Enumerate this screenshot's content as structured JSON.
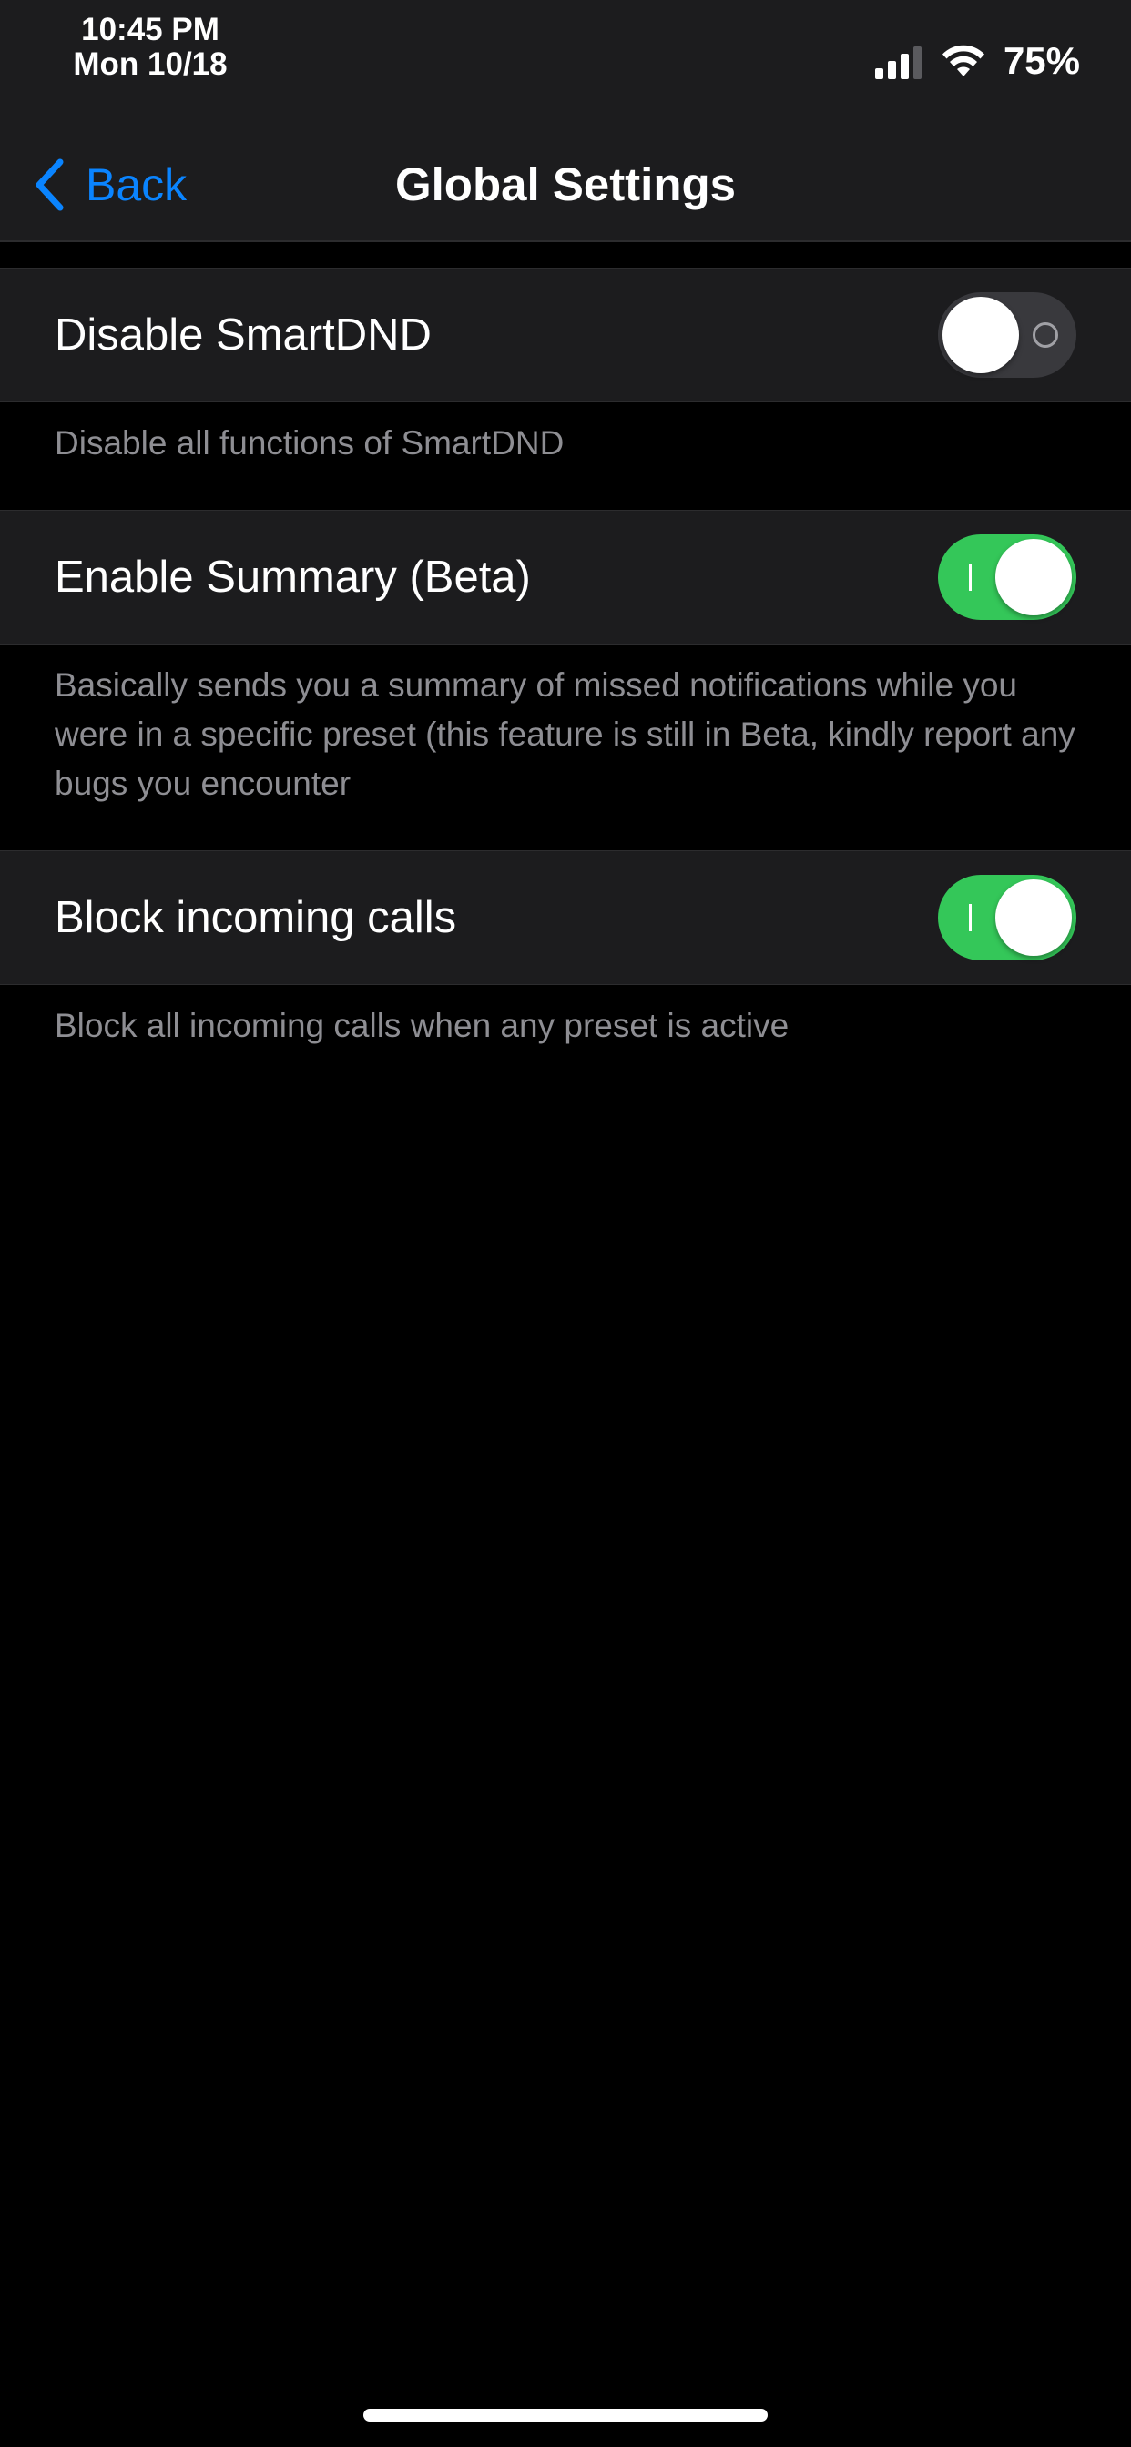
{
  "status_bar": {
    "time": "10:45 PM",
    "date": "Mon 10/18",
    "battery": "75%",
    "icons": [
      "cellular-signal-icon",
      "wifi-icon"
    ]
  },
  "nav": {
    "back_label": "Back",
    "title": "Global Settings",
    "accent_color": "#0a84ff"
  },
  "settings": [
    {
      "label": "Disable SmartDND",
      "enabled": false,
      "description": "Disable all functions of SmartDND"
    },
    {
      "label": "Enable Summary (Beta)",
      "enabled": true,
      "description": "Basically sends you a summary of missed notifications while you were in a specific preset (this feature is still in Beta, kindly report any bugs you encounter"
    },
    {
      "label": "Block incoming calls",
      "enabled": true,
      "description": "Block all incoming calls when any preset is active"
    }
  ],
  "colors": {
    "toggle_on": "#34c759",
    "toggle_off": "#39393d",
    "background": "#000000",
    "row_background": "#1c1c1e",
    "secondary_text": "#8e8e93"
  }
}
